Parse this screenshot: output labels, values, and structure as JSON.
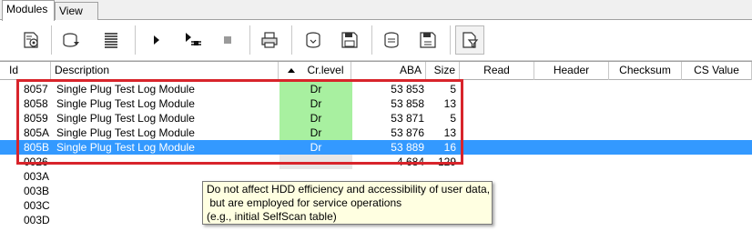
{
  "tabs": [
    {
      "label": "Modules",
      "active": true
    },
    {
      "label": "View",
      "active": false
    }
  ],
  "toolbar": {
    "buttons": [
      {
        "icon": "module-settings-icon"
      },
      {
        "icon": "load-module-icon"
      },
      {
        "icon": "list-icon"
      },
      {
        "icon": "play-icon"
      },
      {
        "icon": "step-run-icon"
      },
      {
        "icon": "stop-icon"
      },
      {
        "icon": "print-icon"
      },
      {
        "icon": "read-disk-icon"
      },
      {
        "icon": "save-disk-icon"
      },
      {
        "icon": "read-disk-alt-icon"
      },
      {
        "icon": "save-disk-alt-icon"
      },
      {
        "icon": "filter-icon"
      }
    ]
  },
  "columns": {
    "id": "Id",
    "description": "Description",
    "cr_level": "Cr.level",
    "aba": "ABA",
    "size": "Size",
    "read": "Read",
    "header": "Header",
    "checksum": "Checksum",
    "cs_value": "CS Value"
  },
  "rows": [
    {
      "id": "8057",
      "description": "Single Plug Test Log Module",
      "cr_level": "Dr",
      "aba": "53 853",
      "size": "5",
      "highlight": "green"
    },
    {
      "id": "8058",
      "description": "Single Plug Test Log Module",
      "cr_level": "Dr",
      "aba": "53 858",
      "size": "13",
      "highlight": "green"
    },
    {
      "id": "8059",
      "description": "Single Plug Test Log Module",
      "cr_level": "Dr",
      "aba": "53 871",
      "size": "5",
      "highlight": "green"
    },
    {
      "id": "805A",
      "description": "Single Plug Test Log Module",
      "cr_level": "Dr",
      "aba": "53 876",
      "size": "13",
      "highlight": "green"
    },
    {
      "id": "805B",
      "description": "Single Plug Test Log Module",
      "cr_level": "Dr",
      "aba": "53 889",
      "size": "16",
      "highlight": "selected"
    },
    {
      "id": "0026",
      "description": "",
      "cr_level": "",
      "aba": "4 684",
      "size": "129",
      "highlight": "gray"
    },
    {
      "id": "003A",
      "description": "",
      "cr_level": "",
      "aba": "",
      "size": "",
      "highlight": "none"
    },
    {
      "id": "003B",
      "description": "",
      "cr_level": "",
      "aba": "",
      "size": "",
      "highlight": "none"
    },
    {
      "id": "003C",
      "description": "",
      "cr_level": "",
      "aba": "",
      "size": "",
      "highlight": "none"
    },
    {
      "id": "003D",
      "description": "",
      "cr_level": "",
      "aba": "",
      "size": "",
      "highlight": "none"
    }
  ],
  "tooltip": {
    "lines": [
      "Do not affect HDD efficiency and accessibility of user data,",
      " but are employed for service operations",
      "(e.g., initial SelfScan table)"
    ]
  },
  "colors": {
    "selection": "#3399ff",
    "green_cell": "#a8f0a0",
    "annotation_box": "#d8242b",
    "tooltip_bg": "#ffffe1"
  }
}
